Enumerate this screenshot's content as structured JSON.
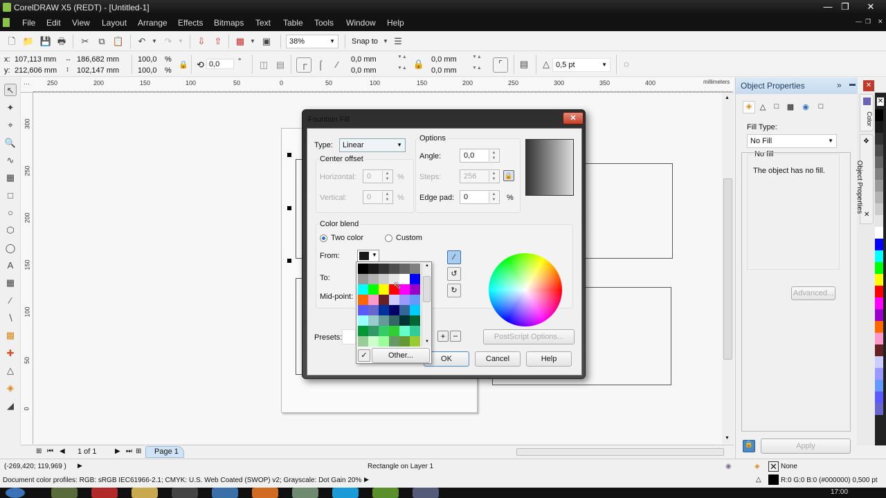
{
  "window": {
    "title": "CorelDRAW X5 (REDT) - [Untitled-1]"
  },
  "menu": [
    "File",
    "Edit",
    "View",
    "Layout",
    "Arrange",
    "Effects",
    "Bitmaps",
    "Text",
    "Table",
    "Tools",
    "Window",
    "Help"
  ],
  "toolbar": {
    "icons": [
      "new-icon",
      "open-icon",
      "save-icon",
      "print-icon",
      "cut-icon",
      "copy-icon",
      "paste-icon",
      "undo-icon",
      "redo-icon",
      "import-icon",
      "export-icon",
      "publish-pdf-icon",
      "application-launcher-icon"
    ],
    "zoom": "38%",
    "snap_to": "Snap to"
  },
  "propbar": {
    "x": "107,113 mm",
    "y": "212,606 mm",
    "width": "186,682 mm",
    "height": "102,147 mm",
    "scale_x": "100,0",
    "scale_y": "100,0",
    "percent": "%",
    "rotation": "0,0",
    "degree": "°",
    "corner_x": "0,0 mm",
    "corner_y": "0,0 mm",
    "corner_x2": "0,0 mm",
    "corner_y2": "0,0 mm",
    "outline_width": "0,5 pt",
    "x_label": "x:",
    "y_label": "y:"
  },
  "ruler": {
    "h_ticks": [
      "250",
      "200",
      "150",
      "100",
      "50",
      "0",
      "50",
      "100",
      "150",
      "200",
      "250",
      "300",
      "350",
      "400"
    ],
    "v_ticks": [
      "300",
      "250",
      "200",
      "150",
      "100",
      "50",
      "0"
    ],
    "units": "millimeters"
  },
  "tools": [
    "pick-tool",
    "shape-tool",
    "crop-tool",
    "zoom-tool",
    "freehand-tool",
    "smart-fill-tool",
    "rectangle-tool",
    "ellipse-tool",
    "polygon-tool",
    "basic-shapes-tool",
    "text-tool",
    "table-tool",
    "dimension-tool",
    "connector-tool",
    "blend-tool",
    "eyedropper-tool",
    "outline-tool",
    "fill-tool",
    "interactive-fill-tool"
  ],
  "dialog": {
    "title": "Fountain Fill",
    "type_label": "Type:",
    "type_value": "Linear",
    "center_offset": "Center offset",
    "horizontal_label": "Horizontal:",
    "horizontal_value": "0",
    "vertical_label": "Vertical:",
    "vertical_value": "0",
    "pct": "%",
    "options": "Options",
    "angle_label": "Angle:",
    "angle_value": "0,0",
    "steps_label": "Steps:",
    "steps_value": "256",
    "edge_pad_label": "Edge pad:",
    "edge_pad_value": "0",
    "color_blend": "Color blend",
    "two_color": "Two color",
    "custom": "Custom",
    "from_label": "From:",
    "to_label": "To:",
    "midpoint_label": "Mid-point:",
    "presets_label": "Presets:",
    "postscript": "PostScript Options...",
    "ok": "OK",
    "cancel": "Cancel",
    "help": "Help",
    "other": "Other...",
    "from_color": "#1a1a1a",
    "palette": [
      "#000000",
      "#1a1a1a",
      "#333333",
      "#4d4d4d",
      "#666666",
      "#808080",
      "#999999",
      "#b3b3b3",
      "#cccccc",
      "#e6e6e6",
      "#ffffff",
      "#0000ff",
      "#00ffff",
      "#00ff00",
      "#ffff00",
      "#ff0000",
      "#ff00ff",
      "#9900cc",
      "#ff6600",
      "#ff99cc",
      "#662222",
      "#ccccff",
      "#9999ff",
      "#6699ff",
      "#5a5aff",
      "#6666cc",
      "#003399",
      "#000066",
      "#336699",
      "#00ccff",
      "#99ffff",
      "#99cccc",
      "#669999",
      "#336666",
      "#003333",
      "#006633",
      "#009933",
      "#339966",
      "#33cc66",
      "#33cc33",
      "#66ffcc",
      "#33cc99",
      "#99cc99",
      "#ccffcc",
      "#99ff99",
      "#669966",
      "#669933",
      "#99cc33"
    ]
  },
  "docker": {
    "title": "Object Properties",
    "fill_type_label": "Fill Type:",
    "fill_type_value": "No Fill",
    "group_title": "No fill",
    "group_text": "The object has no fill.",
    "advanced": "Advanced...",
    "apply": "Apply",
    "tabs": [
      "Color",
      "Object Properties"
    ]
  },
  "color_palette": [
    "#000000",
    "#1a1a1a",
    "#333333",
    "#4d4d4d",
    "#666666",
    "#808080",
    "#999999",
    "#b3b3b3",
    "#cccccc",
    "#e6e6e6",
    "#ffffff",
    "#0000ff",
    "#00ffff",
    "#00ff00",
    "#ffff00",
    "#ff0000",
    "#ff00ff",
    "#9900cc",
    "#ff6600",
    "#ff99cc",
    "#662222",
    "#ccccff",
    "#9999ff",
    "#6699ff",
    "#5a5aff",
    "#6666cc"
  ],
  "page_nav": {
    "count": "1 of 1",
    "page_tab": "Page 1"
  },
  "status": {
    "coords": "(-269,420; 119,969 )",
    "selection": "Rectangle on Layer 1",
    "profiles": "Document color profiles: RGB: sRGB IEC61966-2.1; CMYK: U.S. Web Coated (SWOP) v2; Grayscale: Dot Gain 20%",
    "fill": "None",
    "outline": "R:0 G:0 B:0 (#000000)  0,500 pt",
    "clock": "17:00"
  }
}
